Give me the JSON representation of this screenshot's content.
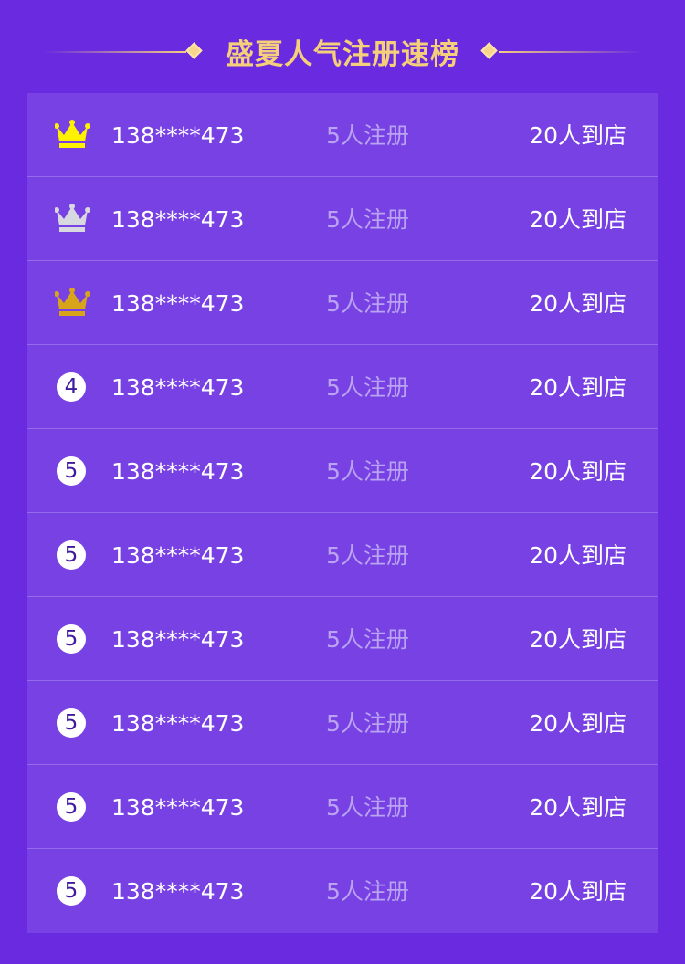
{
  "title": "盛夏人气注册速榜",
  "colors": {
    "background": "#6a2be0",
    "board": "#7841e3",
    "title_gold": "#f5cf7a",
    "gold_crown": "#fff200",
    "silver_crown": "#d8d8e0",
    "bronze_crown": "#d8a51a"
  },
  "rows": [
    {
      "rank_icon": "gold-crown-icon",
      "rank_text": "",
      "phone": "138****473",
      "registered": "5人注册",
      "visited": "20人到店"
    },
    {
      "rank_icon": "silver-crown-icon",
      "rank_text": "",
      "phone": "138****473",
      "registered": "5人注册",
      "visited": "20人到店"
    },
    {
      "rank_icon": "bronze-crown-icon",
      "rank_text": "",
      "phone": "138****473",
      "registered": "5人注册",
      "visited": "20人到店"
    },
    {
      "rank_icon": "",
      "rank_text": "4",
      "phone": "138****473",
      "registered": "5人注册",
      "visited": "20人到店"
    },
    {
      "rank_icon": "",
      "rank_text": "5",
      "phone": "138****473",
      "registered": "5人注册",
      "visited": "20人到店"
    },
    {
      "rank_icon": "",
      "rank_text": "5",
      "phone": "138****473",
      "registered": "5人注册",
      "visited": "20人到店"
    },
    {
      "rank_icon": "",
      "rank_text": "5",
      "phone": "138****473",
      "registered": "5人注册",
      "visited": "20人到店"
    },
    {
      "rank_icon": "",
      "rank_text": "5",
      "phone": "138****473",
      "registered": "5人注册",
      "visited": "20人到店"
    },
    {
      "rank_icon": "",
      "rank_text": "5",
      "phone": "138****473",
      "registered": "5人注册",
      "visited": "20人到店"
    },
    {
      "rank_icon": "",
      "rank_text": "5",
      "phone": "138****473",
      "registered": "5人注册",
      "visited": "20人到店"
    }
  ]
}
